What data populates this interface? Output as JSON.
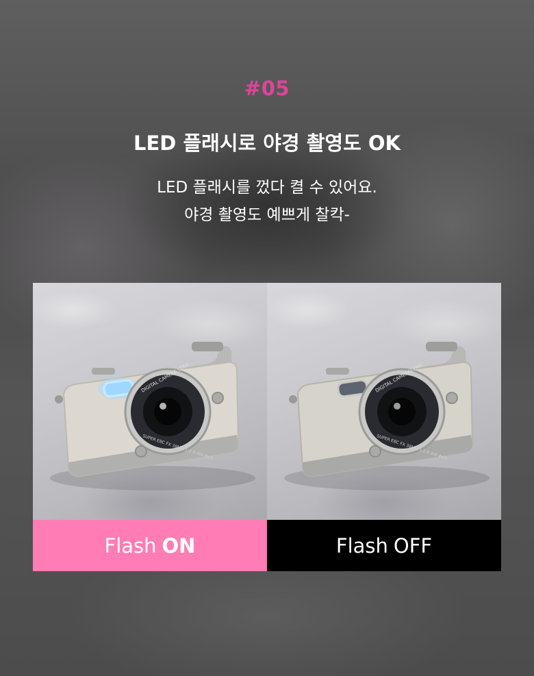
{
  "header": {
    "tag": "#05",
    "title": "LED 플래시로 야경 촬영도 OK",
    "lines": [
      "LED 플래시를 껐다 켤 수 있어요.",
      "야경 촬영도 예쁘게 찰칵-"
    ]
  },
  "panels": [
    {
      "caption_prefix": "Flash",
      "caption_state": "ON",
      "caption_bg": "#ff7cb4",
      "caption_color": "#ffffff",
      "lens_ring_text": "DIGITAL CAMERA LENS",
      "lens_spec_text": "SUPER EBC FX 38MM 1:2 R WR Φ43",
      "flash_on": true
    },
    {
      "caption_prefix": "Flash",
      "caption_state": "OFF",
      "caption_bg": "#000000",
      "caption_color": "#ffffff",
      "lens_ring_text": "DIGITAL CAMERALENS",
      "lens_spec_text": "SUPER EBC FX 38MM 1:2 R WR Φ43",
      "flash_on": false
    }
  ],
  "colors": {
    "accent": "#e0449a",
    "title": "#ffffff"
  }
}
